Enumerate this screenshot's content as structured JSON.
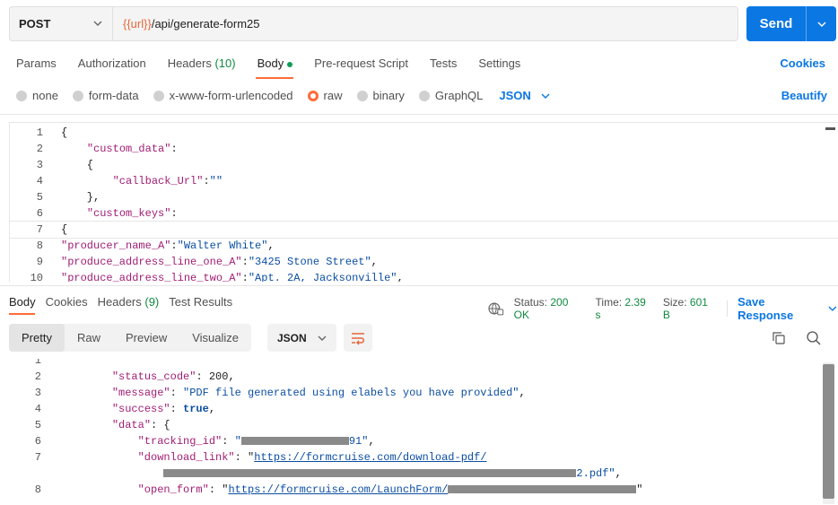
{
  "request": {
    "method": "POST",
    "url_var": "{{url}}",
    "url_path": "/api/generate-form25",
    "send_label": "Send"
  },
  "req_tabs": {
    "params": "Params",
    "authorization": "Authorization",
    "headers": "Headers",
    "headers_count": "(10)",
    "body": "Body",
    "prerequest": "Pre-request Script",
    "tests": "Tests",
    "settings": "Settings",
    "cookies": "Cookies"
  },
  "body_types": {
    "none": "none",
    "form_data": "form-data",
    "urlencoded": "x-www-form-urlencoded",
    "raw": "raw",
    "binary": "binary",
    "graphql": "GraphQL",
    "language": "JSON",
    "beautify": "Beautify"
  },
  "editor_lines": [
    {
      "n": "1",
      "t": "{"
    },
    {
      "n": "2",
      "t": "    \"custom_data\":"
    },
    {
      "n": "3",
      "t": "    {"
    },
    {
      "n": "4",
      "t": "        \"callback_Url\":\"\""
    },
    {
      "n": "5",
      "t": "    },"
    },
    {
      "n": "6",
      "t": "    \"custom_keys\":"
    },
    {
      "n": "7",
      "t": "{"
    },
    {
      "n": "8",
      "t": "\"producer_name_A\":\"Walter White\","
    },
    {
      "n": "9",
      "t": "\"produce_address_line_one_A\":\"3425 Stone Street\","
    },
    {
      "n": "10",
      "t": "\"produce_address_line_two_A\":\"Apt. 2A, Jacksonville\","
    }
  ],
  "resp_tabs": {
    "body": "Body",
    "cookies": "Cookies",
    "headers": "Headers",
    "headers_count": "(9)",
    "test_results": "Test Results"
  },
  "status": {
    "status_label": "Status:",
    "status_value": "200 OK",
    "time_label": "Time:",
    "time_value": "2.39 s",
    "size_label": "Size:",
    "size_value": "601 B",
    "save_response": "Save Response"
  },
  "resp_toolbar": {
    "pretty": "Pretty",
    "raw": "Raw",
    "preview": "Preview",
    "visualize": "Visualize",
    "format": "JSON"
  },
  "response": {
    "l2_key": "\"status_code\"",
    "l2_val": "200",
    "l3_key": "\"message\"",
    "l3_val": "\"PDF file generated using elabels you have provided\"",
    "l4_key": "\"success\"",
    "l4_val": "true",
    "l5_key": "\"data\"",
    "l6_key": "\"tracking_id\"",
    "l6_tail": "91\"",
    "l7_key": "\"download_link\"",
    "l7_link": "https://formcruise.com/download-pdf/",
    "l7_tail": "2.pdf\"",
    "l8_key": "\"open_form\"",
    "l8_link": "https://formcruise.com/LaunchForm/"
  },
  "colors": {
    "accent_orange": "#ff6c37",
    "primary_blue": "#0b77e3",
    "success_green": "#0f8a3f"
  }
}
